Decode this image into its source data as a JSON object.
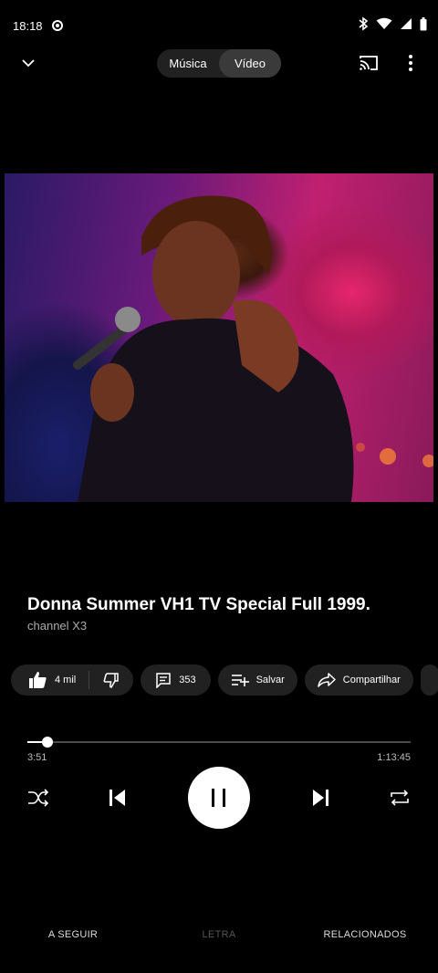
{
  "status_bar": {
    "time": "18:18"
  },
  "top_bar": {
    "toggle": {
      "music_label": "Música",
      "video_label": "Vídeo",
      "selected": "Vídeo"
    }
  },
  "now_playing": {
    "title": "Donna Summer VH1 TV Special Full 1999.",
    "channel": "channel X3"
  },
  "actions": {
    "like_count": "4 mil",
    "comments_count": "353",
    "save_label": "Salvar",
    "share_label": "Compartilhar"
  },
  "playback": {
    "current_time": "3:51",
    "total_time": "1:13:45",
    "progress_fraction": 0.052
  },
  "tabs": {
    "up_next": "A SEGUIR",
    "lyrics": "LETRA",
    "related": "RELACIONADOS"
  },
  "colors": {
    "background": "#000000",
    "pill": "#212121"
  }
}
